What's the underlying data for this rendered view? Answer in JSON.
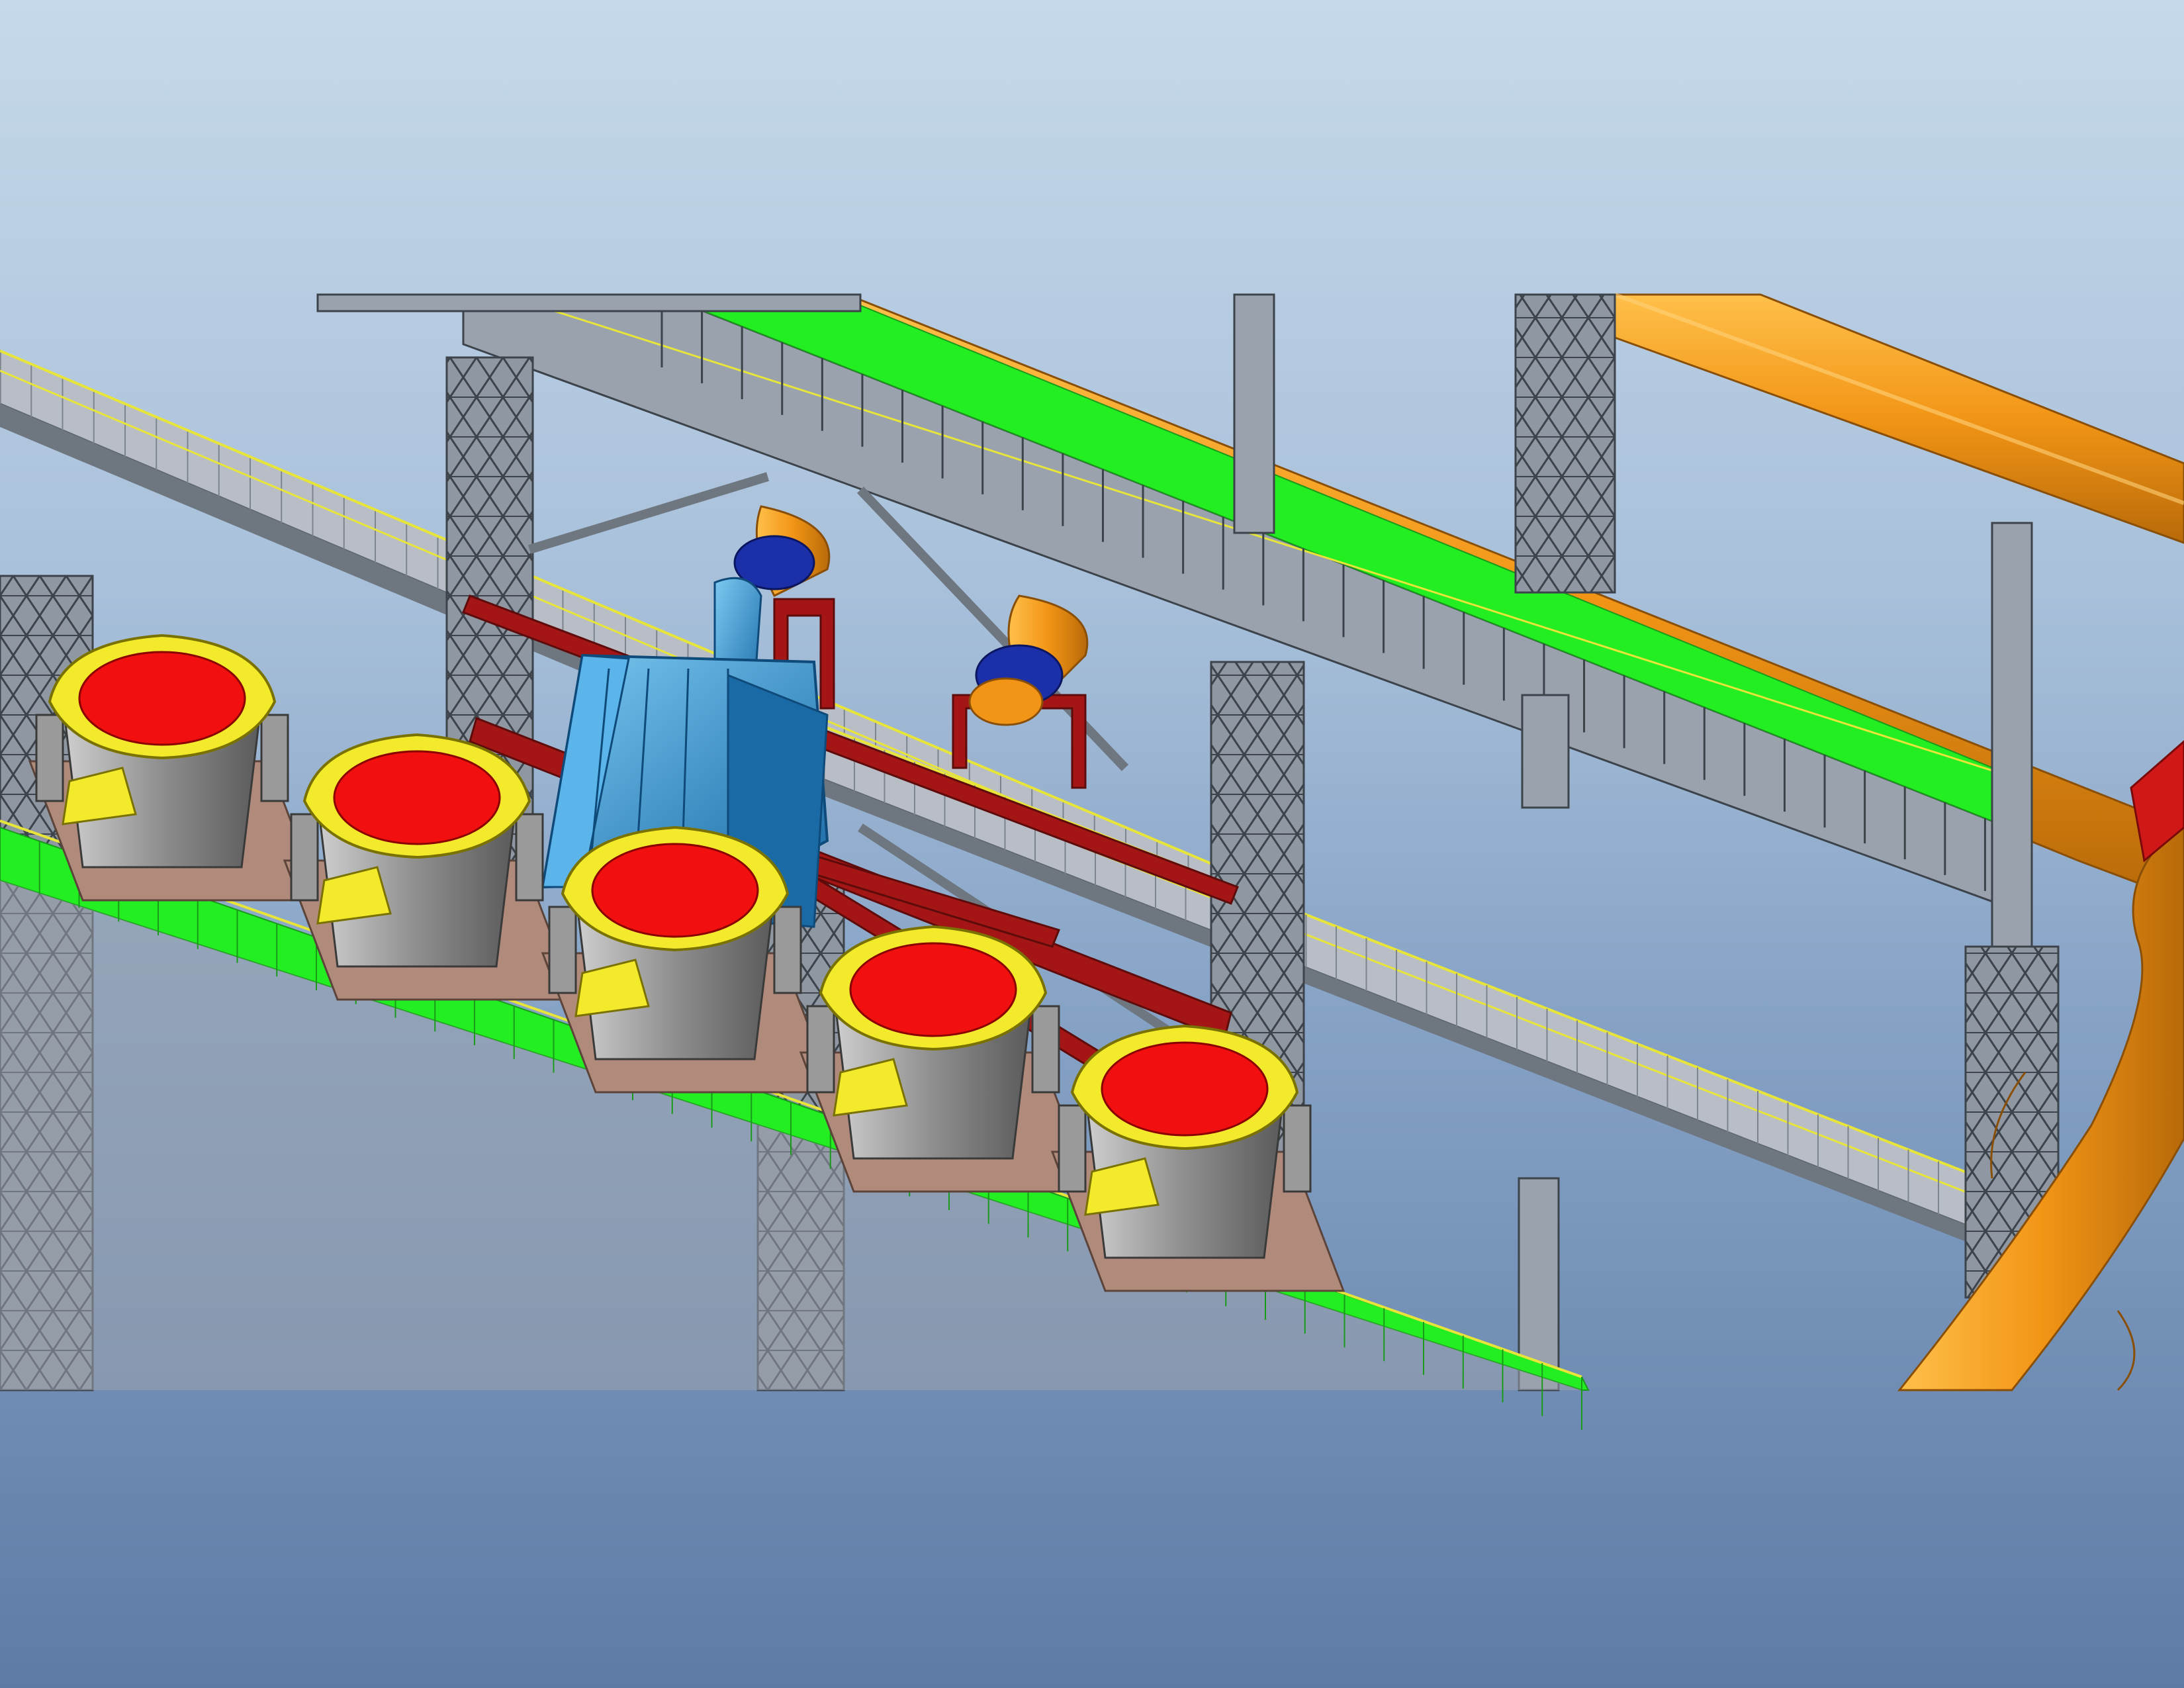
{
  "viewport": {
    "background_top": "#c6d9ea",
    "background_bottom": "#5e7ba6",
    "render_region_note": ""
  },
  "colors": {
    "steel": "#9aa3ad",
    "steel_dark": "#5d656e",
    "steel_edge": "#3c434a",
    "walkway_green": "#22ee22",
    "handrail_yellow": "#e8e53a",
    "pipe_orange": "#f29516",
    "pipe_orange_dark": "#b86a09",
    "hood_blue": "#3aa4e0",
    "hood_blue_dark": "#1a6aa6",
    "flange_navy": "#1b2fa8",
    "frame_red": "#a41616",
    "ladle_grey": "#8e8e8e",
    "ladle_rim_yellow": "#f4ea2c",
    "molten_red": "#f20f0f",
    "car_brown": "#b08a7a",
    "grating_grey": "#b9bec6"
  },
  "components": {
    "ladles_count": 5,
    "columns": [
      "left-column",
      "mid-column",
      "center-column",
      "right-column"
    ]
  }
}
